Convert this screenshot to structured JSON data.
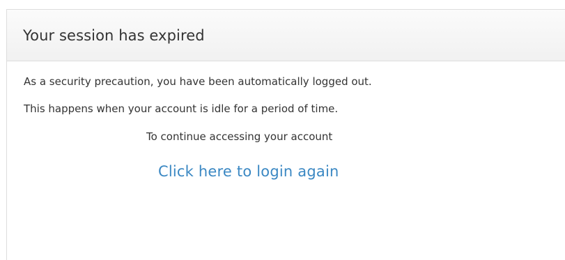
{
  "panel": {
    "title": "Your session has expired",
    "messages": [
      "As a security precaution, you have been automatically logged out.",
      "This happens when your account is idle for a period of time.",
      "To continue accessing your account"
    ],
    "login_link_label": "Click here to login again"
  },
  "colors": {
    "link": "#3b88c3",
    "text": "#333333",
    "border": "#dddddd",
    "header_bg": "#f5f5f5"
  }
}
